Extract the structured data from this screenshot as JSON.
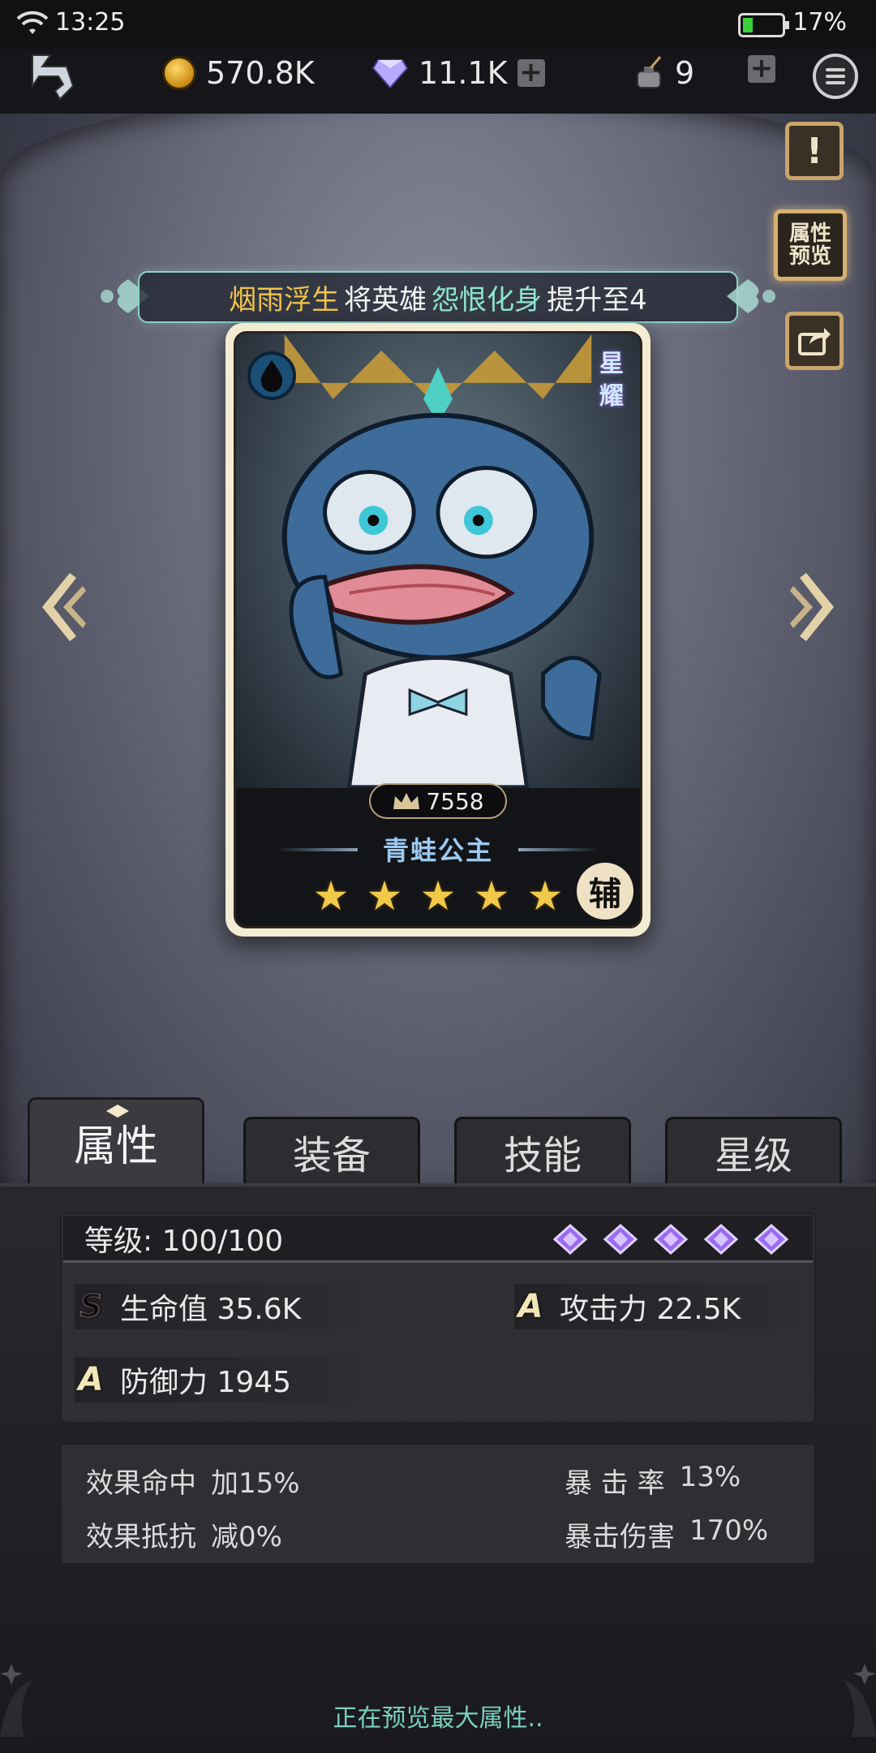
{
  "status_bar": {
    "time": "13:25",
    "battery": "17%"
  },
  "resources": {
    "gold": "570.8K",
    "diamonds": "11.1K",
    "ink": "9"
  },
  "side_buttons": {
    "attr_preview": "属性\n预览"
  },
  "banner": {
    "player": "烟雨浮生",
    "text1": "将英雄",
    "hero_title": "怨恨化身",
    "text2": "提升至4"
  },
  "card": {
    "rank_label": "星\n耀",
    "power": "7558",
    "name": "青蛙公主",
    "stars": 5,
    "role": "辅"
  },
  "tabs": [
    {
      "label": "属性",
      "active": true
    },
    {
      "label": "装备",
      "active": false
    },
    {
      "label": "技能",
      "active": false
    },
    {
      "label": "星级",
      "active": false
    }
  ],
  "stats": {
    "level": "等级: 100/100",
    "level_gems": 5,
    "hp": {
      "grade": "S",
      "label": "生命值 35.6K"
    },
    "atk": {
      "grade": "A",
      "label": "攻击力 22.5K"
    },
    "def": {
      "grade": "A",
      "label": "防御力 1945"
    }
  },
  "extra_stats": {
    "hit_label": "效果命中",
    "hit_value": "加15%",
    "resist_label": "效果抵抗",
    "resist_value": "减0%",
    "crit_label": "暴 击 率",
    "crit_value": "13%",
    "critdmg_label": "暴击伤害",
    "critdmg_value": "170%"
  },
  "footer": "正在预览最大属性..",
  "colors": {
    "accent_gold": "#c9a56a",
    "banner_player": "#f1c34b",
    "banner_hero": "#8ee6d2",
    "footer_teal": "#7ad0c2"
  }
}
